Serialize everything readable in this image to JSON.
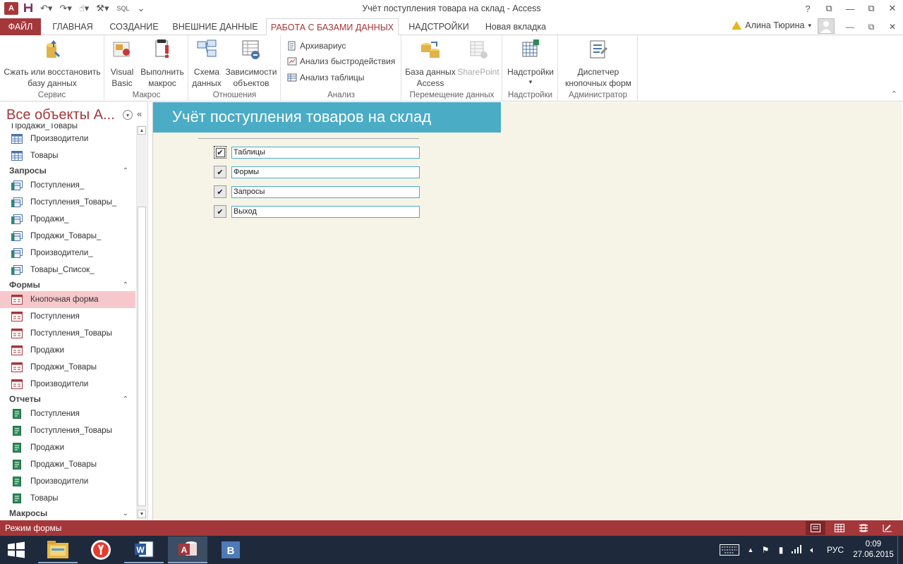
{
  "window": {
    "title": "Учёт поступления товара на склад - Access",
    "help": "?",
    "restore": "⧉",
    "minimize": "—",
    "close": "✕"
  },
  "qat": {
    "app_letter": "A",
    "sql": "SQL"
  },
  "tabs": {
    "file": "ФАЙЛ",
    "home": "ГЛАВНАЯ",
    "create": "СОЗДАНИЕ",
    "external": "ВНЕШНИЕ ДАННЫЕ",
    "database_tools": "РАБОТА С БАЗАМИ ДАННЫХ",
    "addins": "НАДСТРОЙКИ",
    "new_tab": "Новая вкладка"
  },
  "user": {
    "name": "Алина Тюрина"
  },
  "ribbon": {
    "service": {
      "label": "Сервис",
      "compact_line1": "Сжать или восстановить",
      "compact_line2": "базу данных"
    },
    "macro": {
      "label": "Макрос",
      "vb_line1": "Visual",
      "vb_line2": "Basic",
      "run_line1": "Выполнить",
      "run_line2": "макрос"
    },
    "relations": {
      "label": "Отношения",
      "schema_line1": "Схема",
      "schema_line2": "данных",
      "deps_line1": "Зависимости",
      "deps_line2": "объектов"
    },
    "analysis": {
      "label": "Анализ",
      "archivist": "Архивариус",
      "perf": "Анализ быстродействия",
      "table": "Анализ таблицы"
    },
    "move": {
      "label": "Перемещение данных",
      "access_line1": "База данных",
      "access_line2": "Access",
      "sharepoint": "SharePoint"
    },
    "addins": {
      "label": "Надстройки",
      "btn": "Надстройки"
    },
    "admin": {
      "label": "Администратор",
      "sw_line1": "Диспетчер",
      "sw_line2": "кнопочных форм"
    }
  },
  "nav": {
    "title": "Все объекты A...",
    "partial_item": "Продажи_Товары",
    "tables": [
      "Производители",
      "Товары"
    ],
    "queries_header": "Запросы",
    "queries": [
      "Поступления_",
      "Поступления_Товары_",
      "Продажи_",
      "Продажи_Товары_",
      "Производители_",
      "Товары_Список_"
    ],
    "forms_header": "Формы",
    "forms": [
      "Кнопочная форма",
      "Поступления",
      "Поступления_Товары",
      "Продажи",
      "Продажи_Товары",
      "Производители"
    ],
    "reports_header": "Отчеты",
    "reports": [
      "Поступления",
      "Поступления_Товары",
      "Продажи",
      "Продажи_Товары",
      "Производители",
      "Товары"
    ],
    "macros_header": "Макросы"
  },
  "form": {
    "title": "Учёт поступления товаров на склад",
    "items": [
      "Таблицы",
      "Формы",
      "Запросы",
      "Выход"
    ]
  },
  "status": {
    "text": "Режим формы"
  },
  "taskbar": {
    "lang": "РУС",
    "time": "0:09",
    "date": "27.06.2015"
  },
  "colors": {
    "accent": "#a4373a",
    "form_header": "#4bacc6",
    "form_bg": "#f6f4e6"
  }
}
